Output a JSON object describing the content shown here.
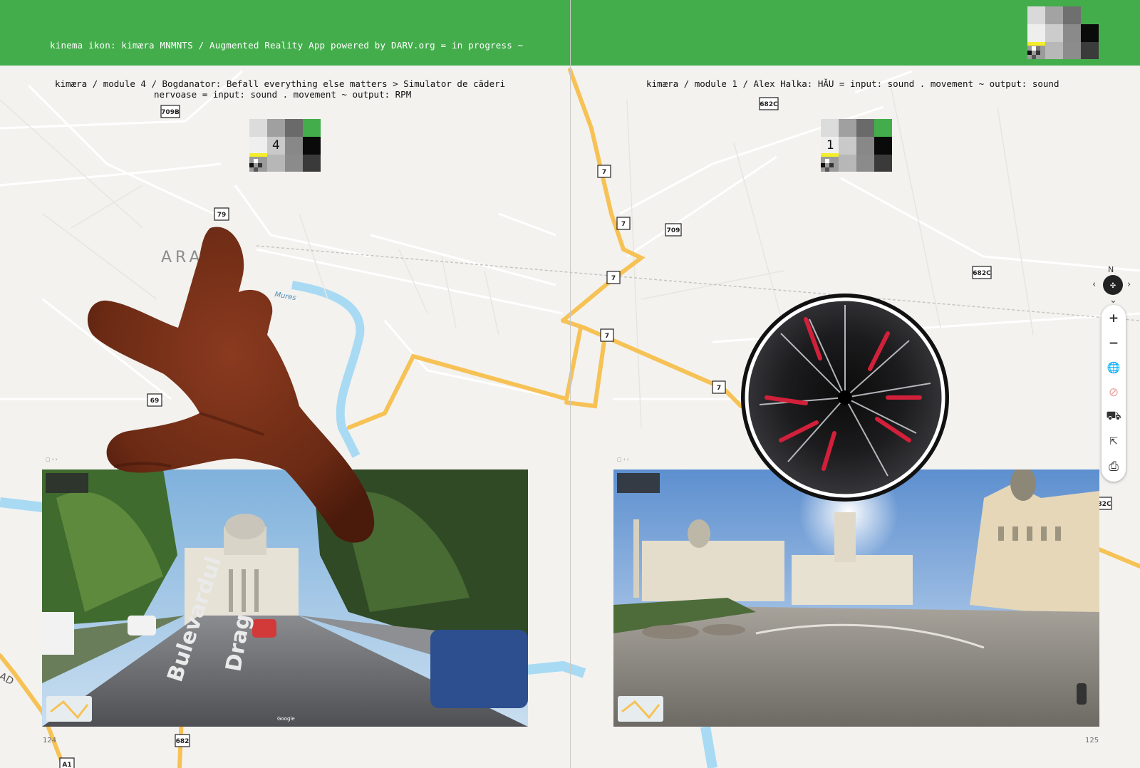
{
  "header": {
    "text": "kinema ikon: kimæra MNMNTS / Augmented Reality App powered by DARV.org = in progress ~",
    "background": "#43ad4b"
  },
  "left_page": {
    "caption_line1": "kimæra / module 4 / Bogdanator: Befall everything else matters > Simulator de căderi",
    "caption_line2": "nervoase = input: sound . movement ~ output: RPM",
    "module_number": "4",
    "page_number": "124",
    "map_city_label": "ARAD",
    "map_river_label": "Mures",
    "map_corner_label": "AD",
    "road_shields": [
      "709B",
      "79",
      "69",
      "682",
      "A1"
    ],
    "street_view": {
      "street_text_1": "Bulevardul",
      "street_text_2": "Drag",
      "watermark": "Google"
    }
  },
  "right_page": {
    "caption": "kimæra / module 1 / Alex Halka: HĂU = input: sound . movement ~ output: sound",
    "module_number": "1",
    "page_number": "125",
    "road_shields": [
      "682C",
      "7",
      "7",
      "709",
      "7",
      "7",
      "7",
      "682C",
      "82C"
    ]
  },
  "map_controls": {
    "compass_label": "N",
    "compass_left_icon": "‹",
    "compass_right_icon": "›",
    "compass_down_icon": "⌄",
    "zoom_in": "+",
    "zoom_out": "−",
    "globe": "🌐",
    "layers_off": "⊘",
    "car": "⛟",
    "share": "⇱",
    "print": "⎙"
  },
  "colors": {
    "accent_green": "#43ad4b",
    "road_yellow": "#f7c255",
    "water_blue": "#a8daf4",
    "map_bg": "#f3f2ef"
  }
}
